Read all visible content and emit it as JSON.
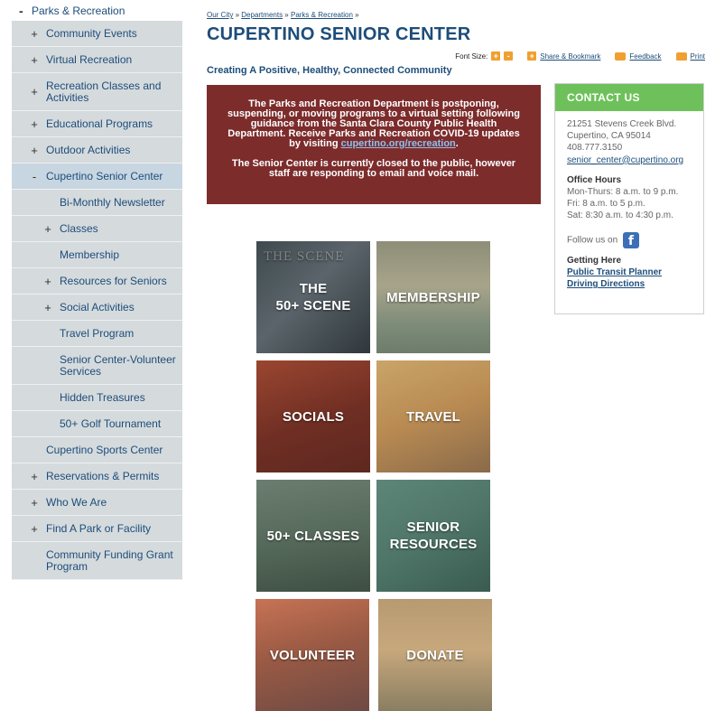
{
  "sidebar": {
    "top": {
      "sign": "-",
      "label": "Parks & Recreation"
    },
    "items": [
      {
        "sign": "+",
        "label": "Community Events"
      },
      {
        "sign": "+",
        "label": "Virtual Recreation"
      },
      {
        "sign": "+",
        "label": "Recreation Classes and Activities"
      },
      {
        "sign": "+",
        "label": "Educational Programs"
      },
      {
        "sign": "+",
        "label": "Outdoor Activities"
      },
      {
        "sign": "-",
        "label": "Cupertino Senior Center"
      },
      {
        "sign": "",
        "label": "Bi-Monthly Newsletter"
      },
      {
        "sign": "+",
        "label": "Classes"
      },
      {
        "sign": "",
        "label": "Membership"
      },
      {
        "sign": "+",
        "label": "Resources for Seniors"
      },
      {
        "sign": "+",
        "label": "Social Activities"
      },
      {
        "sign": "",
        "label": "Travel Program"
      },
      {
        "sign": "",
        "label": "Senior Center-Volunteer Services"
      },
      {
        "sign": "",
        "label": "Hidden Treasures"
      },
      {
        "sign": "",
        "label": "50+ Golf Tournament"
      },
      {
        "sign": "",
        "label": "Cupertino Sports Center"
      },
      {
        "sign": "+",
        "label": "Reservations & Permits"
      },
      {
        "sign": "+",
        "label": "Who We Are"
      },
      {
        "sign": "+",
        "label": "Find A Park or Facility"
      },
      {
        "sign": "",
        "label": "Community Funding Grant Program"
      }
    ]
  },
  "breadcrumb": {
    "items": [
      "Our City",
      "Departments",
      "Parks & Recreation"
    ],
    "separator": "»"
  },
  "page": {
    "title": "CUPERTINO SENIOR CENTER",
    "tagline": "Creating A Positive, Healthy, Connected Community"
  },
  "toolbar": {
    "font_size_label": "Font Size:",
    "font_increase": "+",
    "font_decrease": "-",
    "share_icon": "+",
    "share_label": "Share & Bookmark",
    "feedback_label": "Feedback",
    "print_label": "Print"
  },
  "notice": {
    "paragraph1_pre": "The Parks and Recreation Department is postponing, suspending, or moving programs to a virtual setting following guidance from the Santa Clara County Public Health Department. Receive Parks and Recreation COVID-19 updates by visiting ",
    "paragraph1_link": "cupertino.org/recreation",
    "paragraph1_post": ".",
    "paragraph2": "The Senior Center is currently closed to the public, however staff are responding to email and voice mail."
  },
  "contact": {
    "heading": "CONTACT US",
    "address1": "21251 Stevens Creek Blvd.",
    "address2": "Cupertino, CA 95014",
    "phone": "408.777.3150",
    "email": "senior_center@cupertino.org",
    "hours_heading": "Office Hours",
    "hours1": "Mon-Thurs: 8 a.m. to 9 p.m.",
    "hours2": "Fri: 8 a.m. to 5 p.m.",
    "hours3": "Sat: 8:30 a.m. to 4:30 p.m.",
    "follow_label": "Follow us on",
    "facebook_glyph": "f",
    "getting_here_heading": "Getting Here",
    "transit_link": "Public Transit Planner",
    "directions_link": "Driving Directions"
  },
  "tiles": [
    {
      "line1": "THE",
      "line2": "50+ SCENE",
      "bg_text": "THE SCENE"
    },
    {
      "line1": "MEMBERSHIP",
      "line2": ""
    },
    {
      "line1": "SOCIALS",
      "line2": ""
    },
    {
      "line1": "TRAVEL",
      "line2": ""
    },
    {
      "line1": "50+ CLASSES",
      "line2": ""
    },
    {
      "line1": "SENIOR",
      "line2": "RESOURCES"
    },
    {
      "line1": "VOLUNTEER",
      "line2": ""
    },
    {
      "line1": "DONATE",
      "line2": ""
    }
  ],
  "colors": {
    "nav_bg": "#d5dadd",
    "nav_active": "#c8d6e2",
    "link_blue": "#1d4d7a",
    "notice_bg": "#7d2c2c",
    "contact_head": "#6ec15a",
    "toolbar_orange": "#f0a030"
  }
}
